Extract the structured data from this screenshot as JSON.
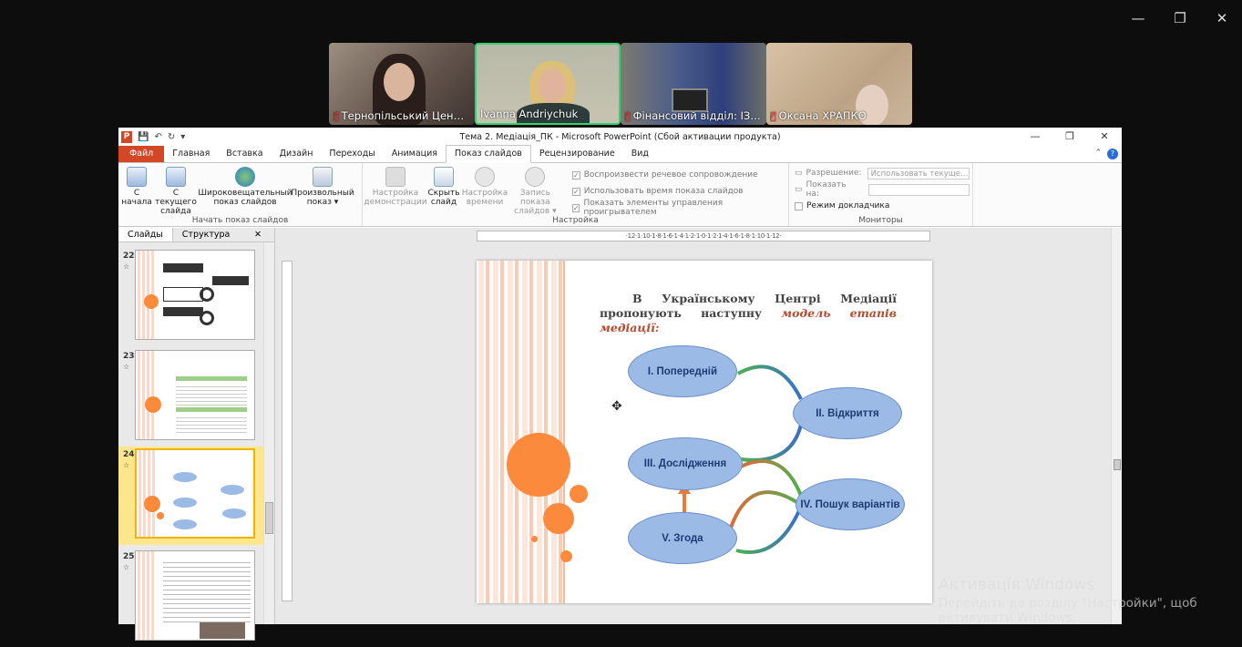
{
  "zoom_window": {
    "controls": [
      "—",
      "❐",
      "✕"
    ]
  },
  "participants": [
    {
      "name": "Тернопільський Цен…",
      "muted": true,
      "active": false
    },
    {
      "name": "Ivanna Andriychuk",
      "muted": false,
      "active": true
    },
    {
      "name": "Фінансовий відділ: ІЗ…",
      "muted": true,
      "active": false
    },
    {
      "name": "Оксана ХРАПКО",
      "muted": true,
      "active": false
    }
  ],
  "ppt": {
    "title": "Тема 2. Медіація_ПК  -  Microsoft PowerPoint (Сбой активации продукта)",
    "tabs": [
      "Файл",
      "Главная",
      "Вставка",
      "Дизайн",
      "Переходы",
      "Анимация",
      "Показ слайдов",
      "Рецензирование",
      "Вид"
    ],
    "selected_tab": "Показ слайдов",
    "groups": {
      "start": {
        "label": "Начать показ слайдов",
        "b1": "С начала",
        "b2": "С текущего слайда",
        "b3": "Широковещательный показ слайдов",
        "b4": "Произвольный показ ▾"
      },
      "setup": {
        "label": "Настройка",
        "b1": "Настройка демонстрации",
        "b2": "Скрыть слайд",
        "b3": "Настройка времени",
        "b4": "Запись показа слайдов ▾",
        "c1": "Воспроизвести речевое сопровождение",
        "c2": "Использовать время показа слайдов",
        "c3": "Показать элементы управления проигрывателем"
      },
      "monitors": {
        "label": "Мониторы",
        "res_label": "Разрешение:",
        "res_value": "Использовать текуще…",
        "show_label": "Показать на:",
        "show_value": "",
        "presenter": "Режим докладчика"
      }
    },
    "panel_tabs": {
      "slides": "Слайды",
      "outline": "Структура"
    },
    "thumbs": [
      "22",
      "23",
      "24",
      "25"
    ],
    "current_thumb": "24",
    "ruler": "·12·1·10·1·8·1·6·1·4·1·2·1·0·1·2·1·4·1·6·1·8·1·10·1·12·",
    "slide": {
      "text_part1": "В Українському Центрі Медіації пропонують наступну ",
      "text_italic": "модель етапів медіації:",
      "stages": {
        "s1": "I. Попередній",
        "s2": "II. Відкриття",
        "s3": "III. Дослідження",
        "s4": "IV. Пошук варіантів",
        "s5": "V. Згода"
      }
    }
  },
  "watermark": {
    "line1": "Активація Windows",
    "line2": "Перейдіть до розділу \"Настройки\", щоб активувати Windows."
  },
  "colors": {
    "accent": "#d24726",
    "ellipse": "#9bbbe6",
    "circle": "#fc8a3c",
    "zoom_active": "#2ed573"
  }
}
